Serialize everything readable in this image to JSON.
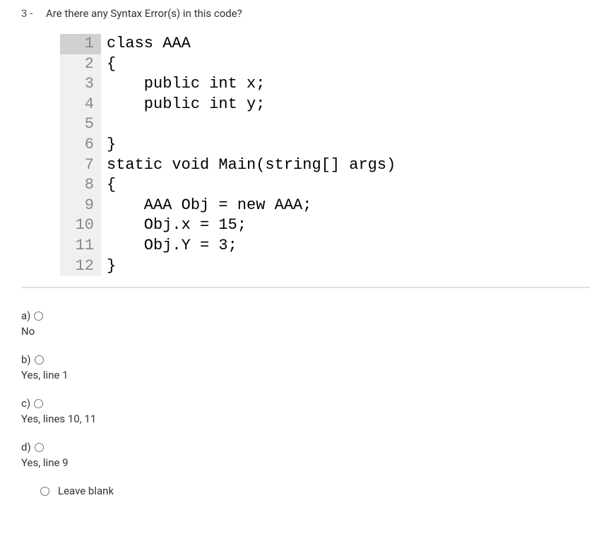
{
  "question": {
    "number": "3 -",
    "text": "Are there any Syntax Error(s) in this code?"
  },
  "code": {
    "lines": [
      {
        "num": "1",
        "highlight": true,
        "content": "class AAA"
      },
      {
        "num": "2",
        "highlight": false,
        "content": "{"
      },
      {
        "num": "3",
        "highlight": false,
        "content": "    public int x;"
      },
      {
        "num": "4",
        "highlight": false,
        "content": "    public int y;"
      },
      {
        "num": "5",
        "highlight": false,
        "content": ""
      },
      {
        "num": "6",
        "highlight": false,
        "content": "}"
      },
      {
        "num": "7",
        "highlight": false,
        "content": "static void Main(string[] args)"
      },
      {
        "num": "8",
        "highlight": false,
        "content": "{"
      },
      {
        "num": "9",
        "highlight": false,
        "content": "    AAA Obj = new AAA;"
      },
      {
        "num": "10",
        "highlight": false,
        "content": "    Obj.x = 15;"
      },
      {
        "num": "11",
        "highlight": false,
        "content": "    Obj.Y = 3;"
      },
      {
        "num": "12",
        "highlight": false,
        "content": "}"
      }
    ]
  },
  "options": [
    {
      "letter": "a)",
      "text": "No"
    },
    {
      "letter": "b)",
      "text": "Yes, line 1"
    },
    {
      "letter": "c)",
      "text": "Yes, lines 10, 11"
    },
    {
      "letter": "d)",
      "text": "Yes, line 9"
    }
  ],
  "leave_blank": "Leave blank"
}
